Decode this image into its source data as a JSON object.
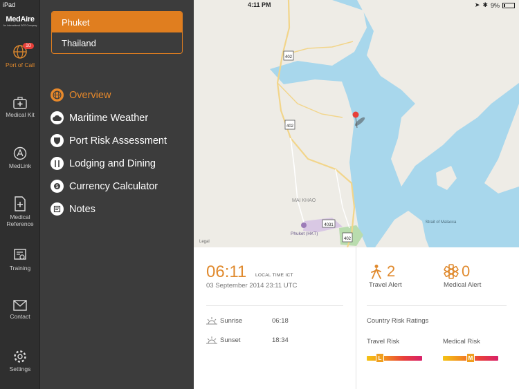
{
  "status": {
    "device": "iPad",
    "time": "4:11 PM",
    "battery": "9%"
  },
  "brand": {
    "name": "MedAire",
    "tagline": "An International SOS Company"
  },
  "rail": {
    "port_badge": "10",
    "items": [
      {
        "label": "Port of Call"
      },
      {
        "label": "Medical Kit"
      },
      {
        "label": "MedLink"
      },
      {
        "label": "Medical Reference"
      },
      {
        "label": "Training"
      },
      {
        "label": "Contact"
      },
      {
        "label": "Settings"
      }
    ]
  },
  "location": {
    "selected": "Phuket",
    "other": "Thailand"
  },
  "menu": {
    "items": [
      {
        "label": "Overview",
        "icon": "globe-icon"
      },
      {
        "label": "Maritime Weather",
        "icon": "cloud-icon"
      },
      {
        "label": "Port Risk Assessment",
        "icon": "shield-icon"
      },
      {
        "label": "Lodging and Dining",
        "icon": "utensils-icon"
      },
      {
        "label": "Currency Calculator",
        "icon": "currency-icon"
      },
      {
        "label": "Notes",
        "icon": "notes-icon"
      }
    ]
  },
  "map": {
    "labels": {
      "town": "MAI KHAO",
      "airport": "Phuket (HKT)",
      "strait": "Strait of Malacca",
      "legal": "Legal"
    },
    "roads": [
      "402",
      "402",
      "4031",
      "402"
    ]
  },
  "overview": {
    "local_time": "06:11",
    "local_time_label": "LOCAL TIME ICT",
    "utc": "03 September 2014 23:11 UTC",
    "sunrise_label": "Sunrise",
    "sunrise": "06:18",
    "sunset_label": "Sunset",
    "sunset": "18:34"
  },
  "alerts": {
    "travel_count": "2",
    "travel_label": "Travel Alert",
    "medical_count": "0",
    "medical_label": "Medical Alert"
  },
  "risk": {
    "title": "Country Risk Ratings",
    "travel_label": "Travel Risk",
    "travel_level": "L",
    "medical_label": "Medical Risk",
    "medical_level": "M"
  },
  "colors": {
    "accent": "#e08a2e",
    "water": "#a8d7ec",
    "alert_badge": "#e8403a"
  }
}
